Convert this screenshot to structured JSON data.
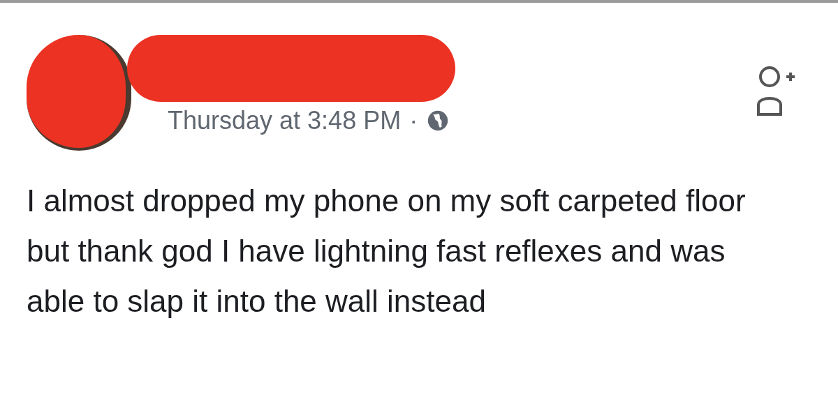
{
  "post": {
    "timestamp": "Thursday at 3:48 PM",
    "separator": "·",
    "text": "I almost dropped my phone on my soft carpeted floor but thank god I have lightning fast reflexes and was able to slap it into the wall instead"
  }
}
